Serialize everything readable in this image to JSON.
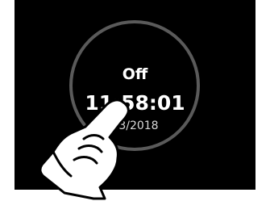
{
  "clock": {
    "status": "Off",
    "time": "11:58:01",
    "date": "03/2018"
  },
  "gesture": {
    "icon": "pointing-hand-icon",
    "action": "tap"
  },
  "colors": {
    "background": "#000000",
    "ring": "#5a5a5a",
    "text": "#ffffff",
    "date_text": "#d8d8d8",
    "frame": "#ffffff"
  }
}
